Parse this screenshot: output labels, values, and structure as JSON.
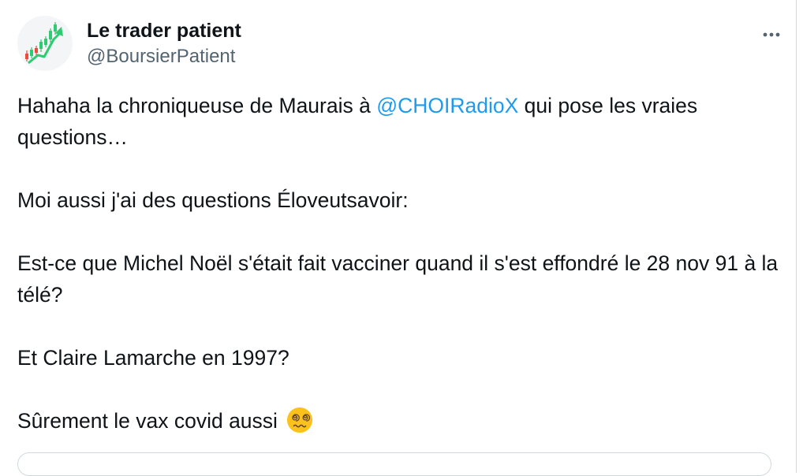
{
  "author": {
    "display_name": "Le trader patient",
    "handle": "@BoursierPatient",
    "avatar_icon": "rising-stock-chart-avatar"
  },
  "more_icon": "more-horizontal-icon",
  "tweet": {
    "line1_before": "Hahaha la chroniqueuse de Maurais à ",
    "mention": "@CHOIRadioX",
    "line1_after": " qui pose les vraies questions…",
    "para2": "Moi aussi j'ai des questions Éloveutsavoir:",
    "para3": "Est-ce que Michel Noël s'était fait vacciner quand il s'est effondré le 28 nov 91 à la télé?",
    "para4": "Et Claire Lamarche en 1997?",
    "para5": "Sûrement le vax covid aussi",
    "emoji_icon": "face-with-spiral-eyes-icon"
  },
  "colors": {
    "text": "#0f1419",
    "secondary": "#536471",
    "link": "#1d9bf0",
    "border": "#cfd9de"
  }
}
